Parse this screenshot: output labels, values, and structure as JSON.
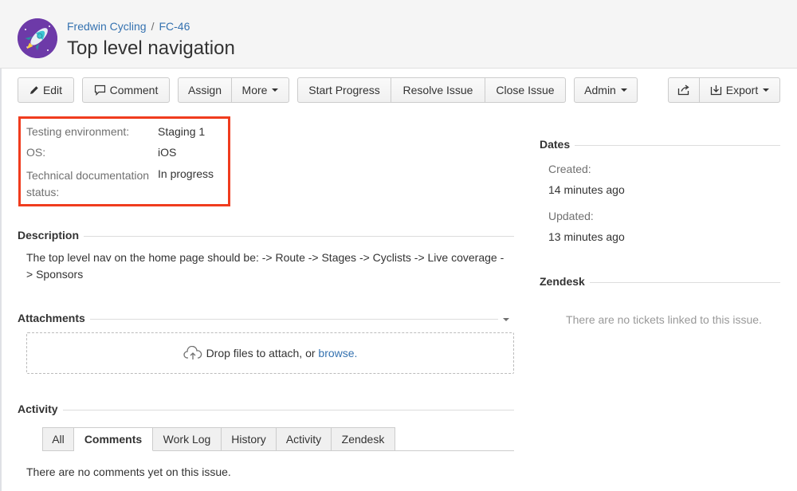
{
  "header": {
    "project": "Fredwin Cycling",
    "separator": "/",
    "issue_key": "FC-46",
    "title": "Top level navigation"
  },
  "toolbar": {
    "edit": "Edit",
    "comment": "Comment",
    "assign": "Assign",
    "more": "More",
    "start_progress": "Start Progress",
    "resolve_issue": "Resolve Issue",
    "close_issue": "Close Issue",
    "admin": "Admin",
    "export": "Export"
  },
  "fields": [
    {
      "label": "Testing environment:",
      "value": "Staging 1"
    },
    {
      "label": "OS:",
      "value": "iOS"
    },
    {
      "label": "Technical documentation status:",
      "value": "In progress"
    }
  ],
  "description": {
    "heading": "Description",
    "text": "The top level nav on the home page should be: -> Route -> Stages -> Cyclists -> Live coverage -> Sponsors"
  },
  "attachments": {
    "heading": "Attachments",
    "drop_text": "Drop files to attach, or ",
    "browse_link": "browse."
  },
  "activity": {
    "heading": "Activity",
    "tabs": [
      "All",
      "Comments",
      "Work Log",
      "History",
      "Activity",
      "Zendesk"
    ],
    "active_tab": "Comments",
    "empty_text": "There are no comments yet on this issue."
  },
  "dates": {
    "heading": "Dates",
    "created_label": "Created:",
    "created_value": "14 minutes ago",
    "updated_label": "Updated:",
    "updated_value": "13 minutes ago"
  },
  "zendesk": {
    "heading": "Zendesk",
    "empty_text": "There are no tickets linked to this issue."
  },
  "colors": {
    "link": "#3572b0",
    "highlight_border": "#f03c1e",
    "avatar_bg": "#6d3aa8"
  }
}
